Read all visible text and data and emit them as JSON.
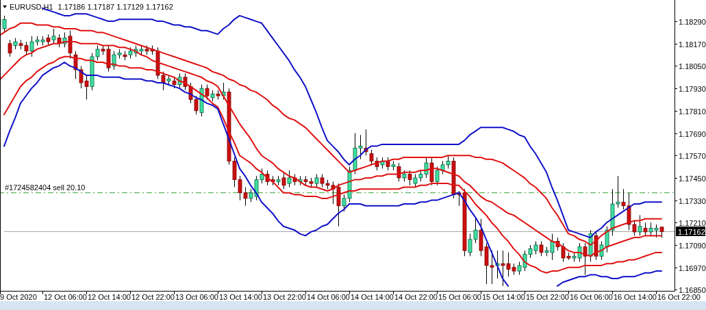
{
  "chart": {
    "symbol": "EURUSD,H1",
    "ohlc": "1.17186 1.17187 1.17129 1.17162",
    "order_label": "#1724582404 sell 20.10",
    "price_label": "1.17162",
    "chart_data": {
      "type": "candlestick",
      "categories": [
        null,
        null,
        null,
        null,
        "9 Oct 2020",
        null,
        null,
        null,
        null,
        null,
        null,
        null,
        "12 Oct 06:00",
        null,
        null,
        null,
        null,
        null,
        null,
        null,
        "12 Oct 14:00",
        null,
        null,
        null,
        null,
        null,
        null,
        null,
        "12 Oct 22:00",
        null,
        null,
        null,
        null,
        null,
        null,
        null,
        "13 Oct 06:00",
        null,
        null,
        null,
        null,
        null,
        null,
        null,
        "13 Oct 14:00",
        null,
        null,
        null,
        null,
        null,
        null,
        null,
        "13 Oct 22:00",
        null,
        null,
        null,
        null,
        null,
        null,
        null,
        "14 Oct 06:00",
        null,
        null,
        null,
        null,
        null,
        null,
        null,
        "14 Oct 14:00",
        null,
        null,
        null,
        null,
        null,
        null,
        null,
        "14 Oct 22:00",
        null,
        null,
        null,
        null,
        null,
        null,
        null,
        "15 Oct 06:00",
        null,
        null,
        null,
        null,
        null,
        null,
        null,
        "15 Oct 14:00",
        null,
        null,
        null,
        null,
        null,
        null,
        null,
        "15 Oct 22:00",
        null,
        null,
        null,
        null,
        null,
        null,
        null,
        "16 Oct 06:00",
        null,
        null,
        null,
        null,
        null,
        null,
        null,
        "16 Oct 14:00",
        null,
        null,
        null,
        null,
        null,
        null,
        null,
        "16 Oct 22:00"
      ],
      "ohlc": [
        [
          1.1827,
          1.1832,
          1.1825,
          1.183
        ],
        [
          1.1825,
          1.1832,
          1.1823,
          1.183
        ],
        [
          1.1817,
          1.1819,
          1.181,
          1.1812
        ],
        [
          1.1816,
          1.182,
          1.1814,
          1.1818
        ],
        [
          1.1817,
          1.1819,
          1.1814,
          1.1816
        ],
        [
          1.1816,
          1.1818,
          1.1811,
          1.1813
        ],
        [
          1.1813,
          1.1821,
          1.181,
          1.1818
        ],
        [
          1.1818,
          1.1821,
          1.1816,
          1.1819
        ],
        [
          1.1818,
          1.1821,
          1.1816,
          1.1819
        ],
        [
          1.182,
          1.1822,
          1.1816,
          1.1818
        ],
        [
          1.1819,
          1.1825,
          1.1817,
          1.1821
        ],
        [
          1.182,
          1.1822,
          1.1815,
          1.1817
        ],
        [
          1.1817,
          1.1823,
          1.1815,
          1.182
        ],
        [
          1.1821,
          1.1824,
          1.1809,
          1.1812
        ],
        [
          1.1811,
          1.1813,
          1.1798,
          1.1803
        ],
        [
          1.1803,
          1.1805,
          1.1793,
          1.1796
        ],
        [
          1.1797,
          1.18,
          1.1787,
          1.1794
        ],
        [
          1.1794,
          1.1812,
          1.1792,
          1.181
        ],
        [
          1.181,
          1.1816,
          1.1808,
          1.1814
        ],
        [
          1.1814,
          1.1816,
          1.1811,
          1.1813
        ],
        [
          1.1814,
          1.1816,
          1.1802,
          1.1804
        ],
        [
          1.1805,
          1.1813,
          1.1803,
          1.1811
        ],
        [
          1.1811,
          1.1814,
          1.1809,
          1.1812
        ],
        [
          1.1811,
          1.1813,
          1.1808,
          1.181
        ],
        [
          1.1811,
          1.1815,
          1.1809,
          1.1813
        ],
        [
          1.1812,
          1.1816,
          1.181,
          1.1814
        ],
        [
          1.1813,
          1.1816,
          1.1811,
          1.1814
        ],
        [
          1.1814,
          1.1816,
          1.1811,
          1.1813
        ],
        [
          1.1814,
          1.1816,
          1.1811,
          1.1813
        ],
        [
          1.1813,
          1.1815,
          1.1798,
          1.18
        ],
        [
          1.18,
          1.1802,
          1.1792,
          1.1796
        ],
        [
          1.1797,
          1.18,
          1.1795,
          1.1798
        ],
        [
          1.1797,
          1.1799,
          1.1793,
          1.1795
        ],
        [
          1.1795,
          1.1801,
          1.1793,
          1.1799
        ],
        [
          1.1799,
          1.1801,
          1.1792,
          1.1794
        ],
        [
          1.1794,
          1.1796,
          1.1785,
          1.1787
        ],
        [
          1.1787,
          1.1789,
          1.1779,
          1.1781
        ],
        [
          1.178,
          1.1795,
          1.1778,
          1.1793
        ],
        [
          1.1793,
          1.1795,
          1.1787,
          1.1789
        ],
        [
          1.1788,
          1.1792,
          1.1786,
          1.179
        ],
        [
          1.179,
          1.1792,
          1.1787,
          1.1789
        ],
        [
          1.1789,
          1.1796,
          1.1787,
          1.1791
        ],
        [
          1.1791,
          1.1793,
          1.1752,
          1.1754
        ],
        [
          1.1754,
          1.1756,
          1.174,
          1.1744
        ],
        [
          1.1744,
          1.1746,
          1.1733,
          1.1737
        ],
        [
          1.1737,
          1.174,
          1.173,
          1.1734
        ],
        [
          1.1734,
          1.1739,
          1.1732,
          1.1737
        ],
        [
          1.1735,
          1.1746,
          1.1733,
          1.1744
        ],
        [
          1.1744,
          1.175,
          1.1742,
          1.1747
        ],
        [
          1.1747,
          1.1749,
          1.1741,
          1.1743
        ],
        [
          1.1744,
          1.1746,
          1.1741,
          1.1743
        ],
        [
          1.1743,
          1.1746,
          1.1741,
          1.1744
        ],
        [
          1.1745,
          1.1748,
          1.1739,
          1.1741
        ],
        [
          1.1742,
          1.1749,
          1.174,
          1.1745
        ],
        [
          1.1745,
          1.1747,
          1.1741,
          1.1743
        ],
        [
          1.1743,
          1.1746,
          1.1741,
          1.1744
        ],
        [
          1.1744,
          1.1746,
          1.1741,
          1.1743
        ],
        [
          1.1743,
          1.1745,
          1.174,
          1.1742
        ],
        [
          1.1742,
          1.1747,
          1.174,
          1.1745
        ],
        [
          1.1745,
          1.1747,
          1.174,
          1.1742
        ],
        [
          1.1742,
          1.1744,
          1.1739,
          1.1741
        ],
        [
          1.1741,
          1.1743,
          1.1731,
          1.1739
        ],
        [
          1.174,
          1.1742,
          1.1719,
          1.173
        ],
        [
          1.173,
          1.1736,
          1.1727,
          1.1734
        ],
        [
          1.1734,
          1.1751,
          1.1732,
          1.1749
        ],
        [
          1.1749,
          1.1769,
          1.1747,
          1.1761
        ],
        [
          1.1761,
          1.1768,
          1.1755,
          1.1762
        ],
        [
          1.1761,
          1.1771,
          1.1757,
          1.1759
        ],
        [
          1.1758,
          1.176,
          1.1752,
          1.1754
        ],
        [
          1.1754,
          1.1756,
          1.1749,
          1.1751
        ],
        [
          1.1752,
          1.1756,
          1.175,
          1.1754
        ],
        [
          1.1754,
          1.1756,
          1.1749,
          1.1751
        ],
        [
          1.1751,
          1.1754,
          1.1749,
          1.1752
        ],
        [
          1.1751,
          1.1753,
          1.1743,
          1.1745
        ],
        [
          1.1745,
          1.1749,
          1.1743,
          1.1747
        ],
        [
          1.1747,
          1.1749,
          1.1741,
          1.1744
        ],
        [
          1.1742,
          1.1747,
          1.174,
          1.1745
        ],
        [
          1.1745,
          1.1749,
          1.1743,
          1.1747
        ],
        [
          1.1747,
          1.1756,
          1.1745,
          1.1753
        ],
        [
          1.1753,
          1.1756,
          1.1741,
          1.1743
        ],
        [
          1.1743,
          1.1751,
          1.1741,
          1.1749
        ],
        [
          1.1749,
          1.1754,
          1.1747,
          1.1752
        ],
        [
          1.1752,
          1.1757,
          1.175,
          1.1754
        ],
        [
          1.1754,
          1.1756,
          1.1734,
          1.1736
        ],
        [
          1.1737,
          1.1738,
          1.173,
          1.1736
        ],
        [
          1.1737,
          1.1739,
          1.1703,
          1.1706
        ],
        [
          1.1705,
          1.1715,
          1.1703,
          1.1712
        ],
        [
          1.1712,
          1.1724,
          1.171,
          1.1717
        ],
        [
          1.1717,
          1.1723,
          1.1703,
          1.1706
        ],
        [
          1.1708,
          1.171,
          1.1688,
          1.1698
        ],
        [
          1.1698,
          1.1706,
          1.1688,
          1.1697
        ],
        [
          1.1698,
          1.1706,
          1.1691,
          1.1699
        ],
        [
          1.1699,
          1.1706,
          1.1687,
          1.1698
        ],
        [
          1.1699,
          1.1705,
          1.1692,
          1.1696
        ],
        [
          1.1697,
          1.1699,
          1.1693,
          1.1695
        ],
        [
          1.1695,
          1.17,
          1.1693,
          1.1698
        ],
        [
          1.1697,
          1.1706,
          1.1695,
          1.1704
        ],
        [
          1.1704,
          1.1709,
          1.1702,
          1.1707
        ],
        [
          1.1706,
          1.1711,
          1.1704,
          1.1709
        ],
        [
          1.1709,
          1.1711,
          1.1703,
          1.1705
        ],
        [
          1.1705,
          1.1708,
          1.1703,
          1.1706
        ],
        [
          1.1705,
          1.1715,
          1.1701,
          1.1711
        ],
        [
          1.1711,
          1.1713,
          1.1706,
          1.1708
        ],
        [
          1.1708,
          1.171,
          1.17,
          1.1702
        ],
        [
          1.1703,
          1.1705,
          1.1701,
          1.1702
        ],
        [
          1.1702,
          1.1705,
          1.17,
          1.1703
        ],
        [
          1.1702,
          1.171,
          1.17,
          1.1708
        ],
        [
          1.1708,
          1.171,
          1.1693,
          1.1703
        ],
        [
          1.1703,
          1.1717,
          1.17,
          1.1715
        ],
        [
          1.1714,
          1.1716,
          1.1701,
          1.1703
        ],
        [
          1.1703,
          1.1711,
          1.1701,
          1.1709
        ],
        [
          1.1708,
          1.1719,
          1.1705,
          1.1717
        ],
        [
          1.1717,
          1.1739,
          1.1714,
          1.1731
        ],
        [
          1.1731,
          1.1746,
          1.1729,
          1.1732
        ],
        [
          1.1732,
          1.1739,
          1.1728,
          1.173
        ],
        [
          1.173,
          1.1737,
          1.1717,
          1.172
        ],
        [
          1.172,
          1.1722,
          1.1714,
          1.1716
        ],
        [
          1.1716,
          1.1725,
          1.1714,
          1.1719
        ],
        [
          1.1718,
          1.1721,
          1.1714,
          1.1716
        ],
        [
          1.1716,
          1.1721,
          1.1714,
          1.1718
        ],
        [
          1.1717,
          1.172,
          1.1713,
          1.1718
        ],
        [
          1.17186,
          1.17187,
          1.17129,
          1.17162
        ],
        null,
        null,
        null
      ],
      "series": [
        {
          "type": "line",
          "color": "#1010c8",
          "values": [
            null,
            null,
            null,
            null,
            null,
            null,
            null,
            null,
            1.1836,
            1.1835,
            1.1834,
            1.1833,
            1.1832,
            1.1832,
            1.1833,
            1.1833,
            1.1833,
            1.1832,
            1.1831,
            1.183,
            1.1829,
            1.1829,
            1.183,
            1.183,
            1.183,
            1.183,
            1.183,
            1.183,
            1.183,
            1.1829,
            1.1829,
            1.1828,
            1.1827,
            1.1827,
            1.1826,
            1.1826,
            1.1825,
            1.1824,
            1.1824,
            1.1823,
            1.1822,
            1.1825,
            1.1827,
            1.183,
            1.1832,
            1.1831,
            1.183,
            1.1829,
            1.1828,
            1.1824,
            1.182,
            1.1816,
            1.1812,
            1.1808,
            1.1803,
            1.1799,
            1.1794,
            1.1787,
            1.178,
            1.1772,
            1.1765,
            1.1762,
            1.1759,
            1.1755,
            1.1752,
            1.1755,
            1.1757,
            1.176,
            1.1762,
            1.1762,
            1.1763,
            1.1763,
            1.1763,
            1.1763,
            1.1763,
            1.1763,
            1.1763,
            1.1763,
            1.1763,
            1.1763,
            1.1763,
            1.1763,
            1.1763,
            1.1763,
            1.1763,
            1.1765,
            1.1768,
            1.177,
            1.1772,
            1.1772,
            1.1772,
            1.1772,
            1.1772,
            1.1771,
            1.177,
            1.1768,
            1.1767,
            1.1762,
            1.1758,
            1.1753,
            1.1748,
            1.174,
            1.1733,
            1.1725,
            1.1717,
            1.1716,
            1.1715,
            1.1714,
            1.1713,
            1.1716,
            1.1718,
            1.1721,
            1.1723,
            1.1725,
            1.1727,
            1.1729,
            1.1731,
            1.1731,
            1.1732,
            1.1732,
            1.1732,
            1.1732,
            null,
            null,
            null
          ]
        },
        {
          "type": "line",
          "color": "#e01010",
          "values": [
            1.1821,
            1.1823,
            1.1825,
            1.1826,
            1.1828,
            1.1828,
            1.1828,
            1.1827,
            1.1827,
            1.1827,
            1.1826,
            1.1826,
            1.1825,
            1.1825,
            1.1825,
            1.1824,
            1.1824,
            1.1824,
            1.1823,
            1.1823,
            1.1822,
            1.1821,
            1.182,
            1.1819,
            1.1818,
            1.1817,
            1.1816,
            1.1815,
            1.1814,
            1.1813,
            1.1812,
            1.1811,
            1.181,
            1.1809,
            1.1808,
            1.1807,
            1.1806,
            1.1805,
            1.1804,
            1.1802,
            1.1801,
            1.18,
            1.1798,
            1.1797,
            1.1795,
            1.1794,
            1.1792,
            1.1791,
            1.1789,
            1.1787,
            1.1784,
            1.1782,
            1.1779,
            1.1777,
            1.1776,
            1.1774,
            1.1772,
            1.1769,
            1.1766,
            1.1763,
            1.176,
            1.1757,
            1.1754,
            1.1751,
            1.1748,
            1.1749,
            1.175,
            1.1751,
            1.1752,
            1.1753,
            1.1754,
            1.1754,
            1.1755,
            1.1755,
            1.1756,
            1.1756,
            1.1756,
            1.1756,
            1.1756,
            1.1756,
            1.1756,
            1.1756,
            1.1757,
            1.1757,
            1.1757,
            1.1757,
            1.1757,
            1.1756,
            1.1756,
            1.1755,
            1.1755,
            1.1754,
            1.1753,
            1.1751,
            1.1749,
            1.1747,
            1.1745,
            1.1742,
            1.174,
            1.1737,
            1.1734,
            1.1729,
            1.1725,
            1.172,
            1.1715,
            1.1714,
            1.1712,
            1.1711,
            1.1709,
            1.1711,
            1.1714,
            1.1716,
            1.1718,
            1.1719,
            1.172,
            1.1721,
            1.1722,
            1.1722,
            1.1723,
            1.1723,
            1.1723,
            1.1723,
            null,
            null,
            null
          ]
        },
        {
          "type": "line",
          "color": "#e01010",
          "values": [
            1.1797,
            1.18,
            1.1803,
            1.1806,
            1.1809,
            1.1811,
            1.1812,
            1.1814,
            1.1815,
            1.1816,
            1.1817,
            1.1817,
            1.1818,
            1.1818,
            1.1818,
            1.1817,
            1.1817,
            1.1817,
            1.1817,
            1.1816,
            1.1816,
            1.1816,
            1.1815,
            1.1815,
            1.1814,
            1.1813,
            1.1811,
            1.181,
            1.1808,
            1.1807,
            1.1806,
            1.1805,
            1.1804,
            1.1803,
            1.1802,
            1.1801,
            1.18,
            1.1799,
            1.1797,
            1.1796,
            1.1794,
            1.1789,
            1.1784,
            1.1779,
            1.1774,
            1.177,
            1.1766,
            1.1761,
            1.1757,
            1.1755,
            1.1753,
            1.175,
            1.1748,
            1.1746,
            1.1745,
            1.1743,
            1.1741,
            1.174,
            1.174,
            1.1739,
            1.1738,
            1.1739,
            1.1741,
            1.1742,
            1.1743,
            1.1744,
            1.1744,
            1.1745,
            1.1745,
            1.1746,
            1.1746,
            1.1747,
            1.1747,
            1.1747,
            1.1748,
            1.1748,
            1.1748,
            1.1749,
            1.1749,
            1.175,
            1.175,
            1.1749,
            1.1748,
            1.1747,
            1.1746,
            1.1743,
            1.1741,
            1.1738,
            1.1735,
            1.1733,
            1.1732,
            1.173,
            1.1728,
            1.1726,
            1.1725,
            1.1723,
            1.1721,
            1.1719,
            1.1717,
            1.1715,
            1.1713,
            1.1711,
            1.171,
            1.1708,
            1.1706,
            1.1705,
            1.1705,
            1.1704,
            1.1703,
            1.1705,
            1.1706,
            1.1708,
            1.1709,
            1.171,
            1.1711,
            1.1712,
            1.1713,
            1.1713,
            1.1714,
            1.1714,
            1.1714,
            1.1714,
            null,
            null,
            null
          ]
        },
        {
          "type": "line",
          "color": "#e01010",
          "values": [
            null,
            1.1779,
            1.1784,
            1.1789,
            1.1794,
            1.1797,
            1.1799,
            1.1802,
            1.1804,
            1.1806,
            1.1807,
            1.1809,
            1.181,
            1.181,
            1.1809,
            1.1809,
            1.1808,
            1.1808,
            1.1807,
            1.1807,
            1.1806,
            1.1806,
            1.1805,
            1.1805,
            1.1804,
            1.1804,
            1.1804,
            1.1803,
            1.1803,
            1.1802,
            1.1801,
            1.18,
            1.1799,
            1.1797,
            1.1796,
            1.1794,
            1.1792,
            1.179,
            1.1788,
            1.1785,
            1.1783,
            1.1777,
            1.177,
            1.1764,
            1.1757,
            1.1755,
            1.1753,
            1.175,
            1.1748,
            1.1745,
            1.1743,
            1.174,
            1.1737,
            1.1737,
            1.1736,
            1.1736,
            1.1735,
            1.1735,
            1.1735,
            1.1734,
            1.1734,
            1.1735,
            1.1736,
            1.1737,
            1.1738,
            1.1738,
            1.1739,
            1.1739,
            1.1739,
            1.1739,
            1.1739,
            1.1739,
            1.1739,
            1.1739,
            1.174,
            1.174,
            1.174,
            1.1741,
            1.1741,
            1.1742,
            1.1742,
            1.1742,
            1.1742,
            1.1741,
            1.1741,
            1.1738,
            1.1735,
            1.1731,
            1.1728,
            1.1725,
            1.1721,
            1.1718,
            1.1714,
            1.1711,
            1.1707,
            1.1704,
            1.17,
            1.1698,
            1.1697,
            1.1695,
            1.1694,
            1.1695,
            1.1695,
            1.1696,
            1.1697,
            1.1697,
            1.1697,
            1.1698,
            1.1698,
            1.1698,
            1.1698,
            1.1699,
            1.1699,
            1.17,
            1.17,
            1.1701,
            1.1701,
            1.1702,
            1.1703,
            1.1704,
            1.1705,
            1.1705,
            null,
            null,
            null
          ]
        },
        {
          "type": "line",
          "color": "#1010c8",
          "values": [
            null,
            1.1762,
            1.177,
            1.1777,
            1.1785,
            1.1789,
            1.1793,
            1.1796,
            1.18,
            1.1802,
            1.1804,
            1.1805,
            1.1807,
            1.1805,
            1.1804,
            1.1802,
            1.18,
            1.18,
            1.18,
            1.1799,
            1.1799,
            1.1799,
            1.1799,
            1.1798,
            1.1798,
            1.1798,
            1.1798,
            1.1797,
            1.1797,
            1.1796,
            1.1796,
            1.1795,
            1.1794,
            1.1793,
            1.1791,
            1.179,
            1.1788,
            1.1787,
            1.1785,
            1.1784,
            1.1782,
            1.1774,
            1.1766,
            1.1758,
            1.175,
            1.1746,
            1.1741,
            1.1737,
            1.1732,
            1.1729,
            1.1726,
            1.1722,
            1.1719,
            1.1718,
            1.1717,
            1.1715,
            1.1714,
            1.1716,
            1.1717,
            1.1719,
            1.172,
            1.1723,
            1.1726,
            1.1728,
            1.1731,
            1.1731,
            1.1731,
            1.173,
            1.173,
            1.173,
            1.173,
            1.173,
            1.173,
            1.173,
            1.1731,
            1.1731,
            1.1731,
            1.1732,
            1.1732,
            1.1733,
            1.1733,
            1.1734,
            1.1735,
            1.1736,
            1.1737,
            1.1733,
            1.1728,
            1.1724,
            1.1719,
            1.1712,
            1.1705,
            1.1698,
            1.1691,
            1.1687,
            null,
            null,
            null,
            null,
            null,
            null,
            null,
            null,
            1.1687,
            1.1689,
            1.169,
            1.1691,
            1.1692,
            1.1692,
            1.1693,
            1.1693,
            1.1692,
            1.1692,
            1.1691,
            1.1691,
            1.1692,
            1.1692,
            1.1692,
            1.1693,
            1.1694,
            1.1694,
            1.1695,
            1.1695,
            null,
            null,
            null
          ]
        },
        {
          "type": "line",
          "line_style": "dashdot",
          "color": "#30a030",
          "values": [
            1.1737,
            1.1737,
            1.1737,
            1.1737,
            1.1737,
            1.1737,
            1.1737,
            1.1737,
            1.1737,
            1.1737,
            1.1737,
            1.1737,
            1.1737,
            1.1737,
            1.1737,
            1.1737,
            1.1737,
            1.1737,
            1.1737,
            1.1737,
            1.1737,
            1.1737,
            1.1737,
            1.1737,
            1.1737,
            1.1737,
            1.1737,
            1.1737,
            1.1737,
            1.1737,
            1.1737,
            1.1737,
            1.1737,
            1.1737,
            1.1737,
            1.1737,
            1.1737,
            1.1737,
            1.1737,
            1.1737,
            1.1737,
            1.1737,
            1.1737,
            1.1737,
            1.1737,
            1.1737,
            1.1737,
            1.1737,
            1.1737,
            1.1737,
            1.1737,
            1.1737,
            1.1737,
            1.1737,
            1.1737,
            1.1737,
            1.1737,
            1.1737,
            1.1737,
            1.1737,
            1.1737,
            1.1737,
            1.1737,
            1.1737,
            1.1737,
            1.1737,
            1.1737,
            1.1737,
            1.1737,
            1.1737,
            1.1737,
            1.1737,
            1.1737,
            1.1737,
            1.1737,
            1.1737,
            1.1737,
            1.1737,
            1.1737,
            1.1737,
            1.1737,
            1.1737,
            1.1737,
            1.1737,
            1.1737,
            1.1737,
            1.1737,
            1.1737,
            1.1737,
            1.1737,
            1.1737,
            1.1737,
            1.1737,
            1.1737,
            1.1737,
            1.1737,
            1.1737,
            1.1737,
            1.1737,
            1.1737,
            1.1737,
            1.1737,
            1.1737,
            1.1737,
            1.1737,
            1.1737,
            1.1737,
            1.1737,
            1.1737,
            1.1737,
            1.1737,
            1.1737,
            1.1737,
            1.1737,
            1.1737,
            1.1737,
            1.1737,
            1.1737,
            1.1737,
            1.1737,
            1.1737,
            1.1737,
            1.1737,
            1.1737,
            1.1737
          ]
        },
        {
          "type": "line",
          "color": "#a0a0a0",
          "values": [
            null,
            1.17162,
            1.17162,
            1.17162,
            1.17162,
            1.17162,
            1.17162,
            1.17162,
            1.17162,
            1.17162,
            1.17162,
            1.17162,
            1.17162,
            1.17162,
            1.17162,
            1.17162,
            1.17162,
            1.17162,
            1.17162,
            1.17162,
            1.17162,
            1.17162,
            1.17162,
            1.17162,
            1.17162,
            1.17162,
            1.17162,
            1.17162,
            1.17162,
            1.17162,
            1.17162,
            1.17162,
            1.17162,
            1.17162,
            1.17162,
            1.17162,
            1.17162,
            1.17162,
            1.17162,
            1.17162,
            1.17162,
            1.17162,
            1.17162,
            1.17162,
            1.17162,
            1.17162,
            1.17162,
            1.17162,
            1.17162,
            1.17162,
            1.17162,
            1.17162,
            1.17162,
            1.17162,
            1.17162,
            1.17162,
            1.17162,
            1.17162,
            1.17162,
            1.17162,
            1.17162,
            1.17162,
            1.17162,
            1.17162,
            1.17162,
            1.17162,
            1.17162,
            1.17162,
            1.17162,
            1.17162,
            1.17162,
            1.17162,
            1.17162,
            1.17162,
            1.17162,
            1.17162,
            1.17162,
            1.17162,
            1.17162,
            1.17162,
            1.17162,
            1.17162,
            1.17162,
            1.17162,
            1.17162,
            1.17162,
            1.17162,
            1.17162,
            1.17162,
            1.17162,
            1.17162,
            1.17162,
            1.17162,
            1.17162,
            1.17162,
            1.17162,
            1.17162,
            1.17162,
            1.17162,
            1.17162,
            1.17162,
            1.17162,
            1.17162,
            1.17162,
            1.17162,
            1.17162,
            1.17162,
            1.17162,
            1.17162,
            1.17162,
            1.17162,
            1.17162,
            1.17162,
            1.17162,
            1.17162,
            1.17162,
            1.17162,
            1.17162,
            1.17162,
            1.17162,
            1.17162,
            1.17162,
            1.17162,
            1.17162,
            1.17162
          ]
        }
      ],
      "ylim": [
        1.16844,
        1.18404
      ],
      "yticks": [
        {
          "value": 1.1829,
          "label": "1.18290"
        },
        {
          "value": 1.1817,
          "label": "1.18170"
        },
        {
          "value": 1.1805,
          "label": "1.18050"
        },
        {
          "value": 1.1793,
          "label": "1.17930"
        },
        {
          "value": 1.1781,
          "label": "1.17810"
        },
        {
          "value": 1.1769,
          "label": "1.17690"
        },
        {
          "value": 1.1757,
          "label": "1.17570"
        },
        {
          "value": 1.1745,
          "label": "1.17450"
        },
        {
          "value": 1.1733,
          "label": "1.17330"
        },
        {
          "value": 1.1721,
          "label": "1.17210"
        },
        {
          "value": 1.1709,
          "label": "1.17090"
        },
        {
          "value": 1.1697,
          "label": "1.16970"
        },
        {
          "value": 1.1685,
          "label": "1.16850"
        }
      ]
    }
  }
}
